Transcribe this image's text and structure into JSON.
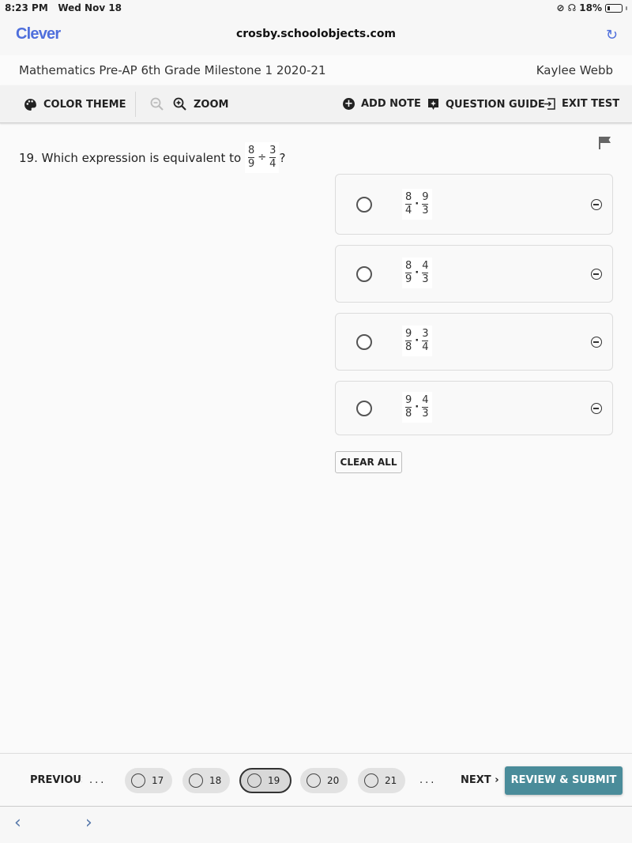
{
  "status_bar": {
    "time": "8:23 PM",
    "date": "Wed Nov 18",
    "battery": "18%"
  },
  "browser": {
    "brand": "Clever",
    "url": "crosby.schoolobjects.com"
  },
  "test_header": {
    "title": "Mathematics Pre-AP 6th Grade Milestone 1 2020-21",
    "user": "Kaylee Webb"
  },
  "toolbar": {
    "color_theme": "COLOR THEME",
    "zoom": "ZOOM",
    "add_note": "ADD NOTE",
    "question_guide": "QUESTION GUIDE",
    "exit_test": "EXIT TEST"
  },
  "question": {
    "text": "19. Which expression is equivalent to",
    "expr": {
      "a_num": "8",
      "a_den": "9",
      "op": "÷",
      "b_num": "3",
      "b_den": "4"
    },
    "end": "?"
  },
  "choices": [
    {
      "a_num": "8",
      "a_den": "4",
      "b_num": "9",
      "b_den": "3",
      "op": "·"
    },
    {
      "a_num": "8",
      "a_den": "9",
      "b_num": "4",
      "b_den": "3",
      "op": "·"
    },
    {
      "a_num": "9",
      "a_den": "8",
      "b_num": "3",
      "b_den": "4",
      "op": "·"
    },
    {
      "a_num": "9",
      "a_den": "8",
      "b_num": "4",
      "b_den": "3",
      "op": "·"
    }
  ],
  "clear_all": "CLEAR ALL",
  "footer": {
    "previous": "PREVIOUS",
    "ellipsis": "...",
    "pages": [
      "17",
      "18",
      "19",
      "20",
      "21"
    ],
    "current": "19",
    "next": "NEXT",
    "next_arrow": "›",
    "review": "REVIEW & SUBMIT"
  },
  "nav": {
    "back": "‹",
    "forward": "›"
  }
}
